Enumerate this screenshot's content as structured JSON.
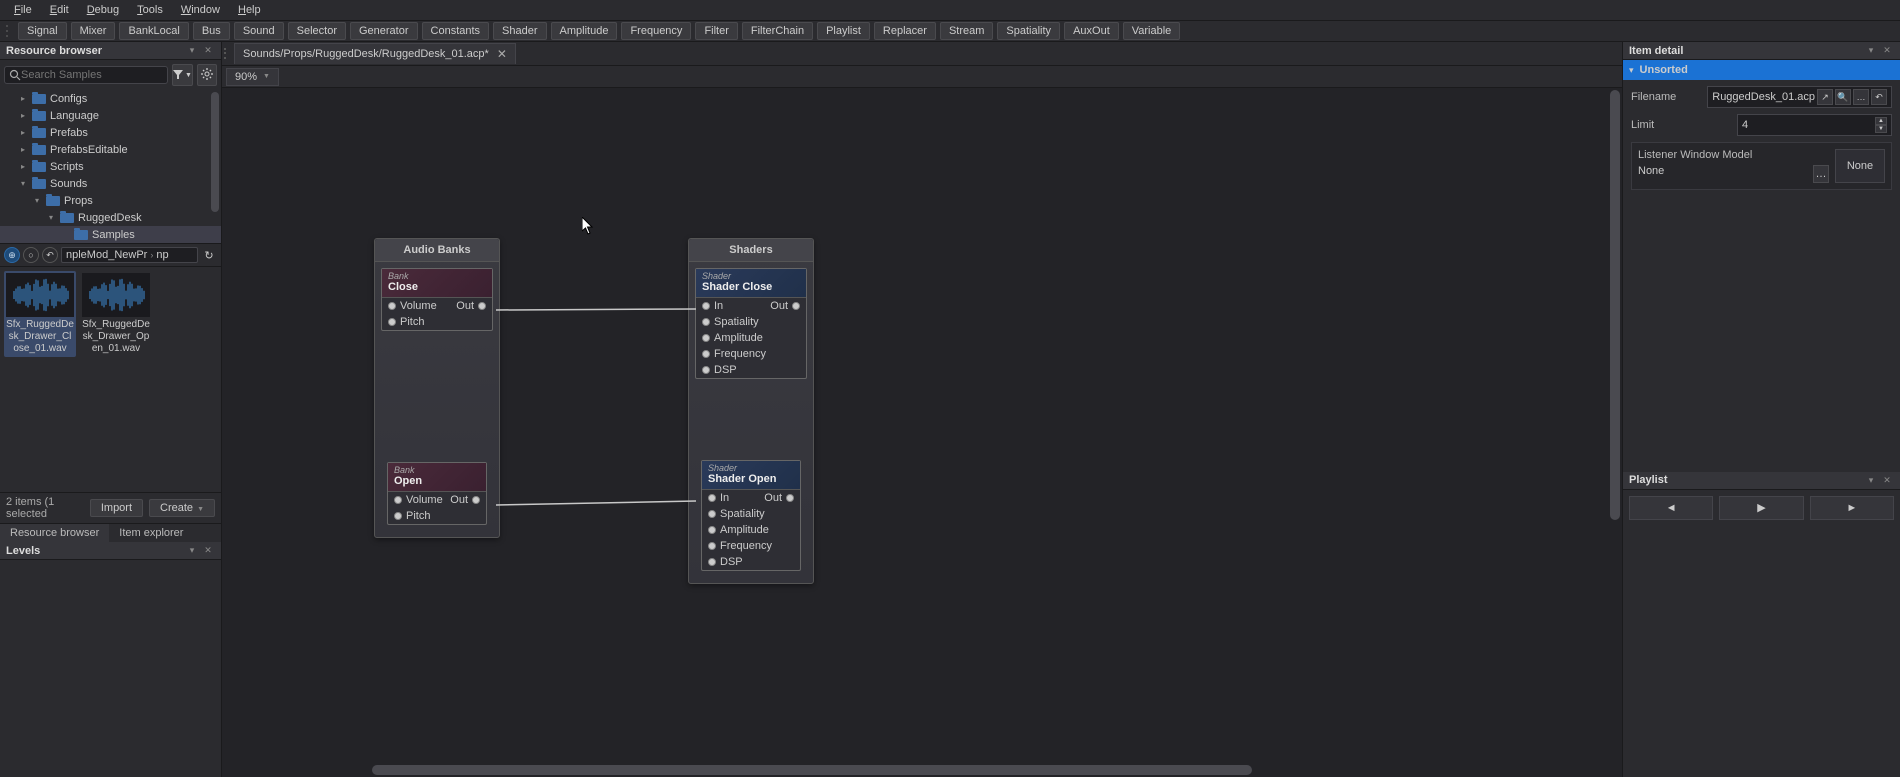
{
  "menu": [
    "File",
    "Edit",
    "Debug",
    "Tools",
    "Window",
    "Help"
  ],
  "toolbar": [
    "Signal",
    "Mixer",
    "BankLocal",
    "Bus",
    "Sound",
    "Selector",
    "Generator",
    "Constants",
    "Shader",
    "Amplitude",
    "Frequency",
    "Filter",
    "FilterChain",
    "Playlist",
    "Replacer",
    "Stream",
    "Spatiality",
    "AuxOut",
    "Variable"
  ],
  "left": {
    "title": "Resource browser",
    "search_placeholder": "Search Samples",
    "tree": [
      {
        "indent": 1,
        "arrow": "▸",
        "label": "Configs"
      },
      {
        "indent": 1,
        "arrow": "▸",
        "label": "Language"
      },
      {
        "indent": 1,
        "arrow": "▸",
        "label": "Prefabs"
      },
      {
        "indent": 1,
        "arrow": "▸",
        "label": "PrefabsEditable"
      },
      {
        "indent": 1,
        "arrow": "▸",
        "label": "Scripts"
      },
      {
        "indent": 1,
        "arrow": "▾",
        "label": "Sounds"
      },
      {
        "indent": 2,
        "arrow": "▾",
        "label": "Props"
      },
      {
        "indent": 3,
        "arrow": "▾",
        "label": "RuggedDesk"
      },
      {
        "indent": 4,
        "arrow": "",
        "label": "Samples",
        "selected": true
      }
    ],
    "path_seg1": "npleMod_NewPr",
    "path_seg2": "np",
    "thumbs": [
      {
        "name": "Sfx_RuggedDesk_Drawer_Close_01.wav",
        "selected": true
      },
      {
        "name": "Sfx_RuggedDesk_Drawer_Open_01.wav",
        "selected": false
      }
    ],
    "status": "2 items (1 selected",
    "import": "Import",
    "create": "Create",
    "tabs": [
      "Resource browser",
      "Item explorer"
    ],
    "levels_title": "Levels"
  },
  "center": {
    "doc_tab": "Sounds/Props/RuggedDesk/RuggedDesk_01.acp*",
    "zoom": "90%",
    "groups": {
      "banks": {
        "title": "Audio Banks",
        "nodes": [
          {
            "type": "Bank",
            "name": "Close",
            "ports_left": [
              "Volume",
              "Pitch"
            ],
            "port_right": "Out"
          },
          {
            "type": "Bank",
            "name": "Open",
            "ports_left": [
              "Volume",
              "Pitch"
            ],
            "port_right": "Out"
          }
        ]
      },
      "shaders": {
        "title": "Shaders",
        "nodes": [
          {
            "type": "Shader",
            "name": "Shader Close",
            "ports_left": [
              "In",
              "Spatiality",
              "Amplitude",
              "Frequency",
              "DSP"
            ],
            "port_right": "Out"
          },
          {
            "type": "Shader",
            "name": "Shader Open",
            "ports_left": [
              "In",
              "Spatiality",
              "Amplitude",
              "Frequency",
              "DSP"
            ],
            "port_right": "Out"
          }
        ]
      }
    }
  },
  "right": {
    "title": "Item detail",
    "section": "Unsorted",
    "filename_label": "Filename",
    "filename_value": "RuggedDesk_01.acp",
    "limit_label": "Limit",
    "limit_value": "4",
    "lwm_label": "Listener Window Model",
    "lwm_value": "None",
    "none_box": "None",
    "playlist_title": "Playlist"
  }
}
